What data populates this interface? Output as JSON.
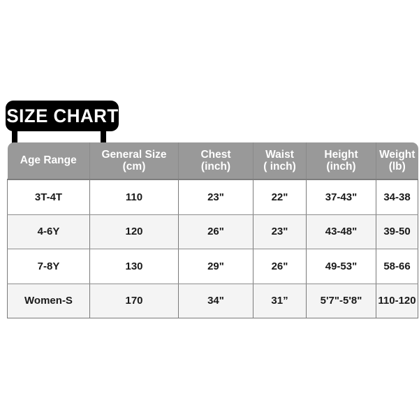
{
  "banner": {
    "title": "SIZE CHART"
  },
  "table": {
    "headers": [
      {
        "line1": "Age Range",
        "line2": ""
      },
      {
        "line1": "General Size",
        "line2": "(cm)"
      },
      {
        "line1": "Chest",
        "line2": "(inch)"
      },
      {
        "line1": "Waist",
        "line2": "( inch)"
      },
      {
        "line1": "Height",
        "line2": "(inch)"
      },
      {
        "line1": "Weight",
        "line2": "(lb)"
      }
    ],
    "rows": [
      {
        "age_range": "3T-4T",
        "general_size_cm": "110",
        "chest_inch": "23\"",
        "waist_inch": "22\"",
        "height_inch": "37-43\"",
        "weight_lb": "34-38"
      },
      {
        "age_range": "4-6Y",
        "general_size_cm": "120",
        "chest_inch": "26\"",
        "waist_inch": "23\"",
        "height_inch": "43-48\"",
        "weight_lb": "39-50"
      },
      {
        "age_range": "7-8Y",
        "general_size_cm": "130",
        "chest_inch": "29\"",
        "waist_inch": "26\"",
        "height_inch": "49-53\"",
        "weight_lb": "58-66"
      },
      {
        "age_range": "Women-S",
        "general_size_cm": "170",
        "chest_inch": "34\"",
        "waist_inch": "31”",
        "height_inch": "5'7\"-5'8\"",
        "weight_lb": "110-120"
      }
    ]
  },
  "colors": {
    "banner_background": "#000000",
    "banner_text": "#ffffff",
    "header_background": "#999999",
    "header_text": "#ffffff",
    "row_odd_background": "#ffffff",
    "row_even_background": "#f4f4f4",
    "cell_text": "#1a1a1a"
  }
}
